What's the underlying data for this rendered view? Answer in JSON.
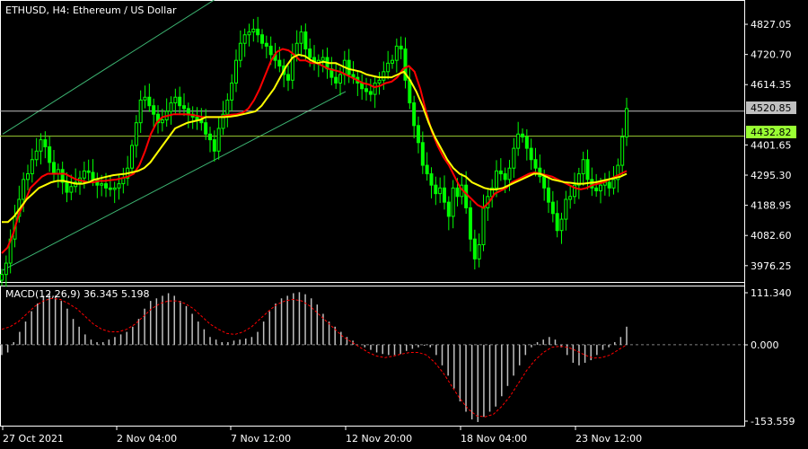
{
  "header": {
    "symbol": "ETHUSD",
    "timeframe": "H4:",
    "description": "Ethereum / US Dollar"
  },
  "indicator": {
    "label": "MACD(12,26,9) 36.345 5.198",
    "top_value": "111.340",
    "zero_value": "0.000",
    "bottom_value": "-153.559"
  },
  "price_scale": [
    "4827.05",
    "4720.70",
    "4614.35",
    "4401.65",
    "4295.30",
    "4188.95",
    "4082.60",
    "3976.25"
  ],
  "badges": {
    "bid": "4520.85",
    "level": "4432.82"
  },
  "time_axis": [
    "27 Oct 2021",
    "2 Nov 04:00",
    "7 Nov 12:00",
    "12 Nov 20:00",
    "18 Nov 04:00",
    "23 Nov 12:00"
  ],
  "colors": {
    "background": "#000000",
    "candles": "#00ff00",
    "ma_fast": "#ff0000",
    "ma_slow": "#ffff00",
    "channel": "#3cb371",
    "bid_line": "#c0c0c0",
    "level_line": "#9acd32",
    "level_badge": "#99ff33",
    "macd_hist": "#c0c0c0",
    "macd_signal": "#ff0000",
    "grid": "#ffffff"
  },
  "chart_data": {
    "type": "candlestick",
    "symbol": "ETHUSD",
    "timeframe": "H4",
    "price_range": [
      3925,
      4900
    ],
    "close": [
      3945,
      3985,
      4070,
      4150,
      4210,
      4280,
      4300,
      4350,
      4380,
      4420,
      4395,
      4340,
      4300,
      4315,
      4270,
      4235,
      4255,
      4270,
      4285,
      4310,
      4305,
      4280,
      4260,
      4265,
      4250,
      4245,
      4250,
      4265,
      4285,
      4320,
      4400,
      4480,
      4560,
      4570,
      4540,
      4510,
      4480,
      4490,
      4520,
      4550,
      4570,
      4540,
      4530,
      4510,
      4500,
      4490,
      4480,
      4440,
      4420,
      4380,
      4460,
      4510,
      4560,
      4620,
      4700,
      4760,
      4790,
      4800,
      4810,
      4790,
      4760,
      4750,
      4720,
      4700,
      4680,
      4650,
      4630,
      4720,
      4760,
      4800,
      4740,
      4710,
      4690,
      4700,
      4710,
      4670,
      4640,
      4620,
      4650,
      4700,
      4650,
      4640,
      4620,
      4600,
      4590,
      4580,
      4620,
      4630,
      4660,
      4690,
      4700,
      4750,
      4740,
      4630,
      4550,
      4470,
      4410,
      4330,
      4300,
      4260,
      4230,
      4250,
      4200,
      4150,
      4250,
      4220,
      4260,
      4180,
      4070,
      4000,
      4050,
      4180,
      4220,
      4250,
      4310,
      4300,
      4280,
      4320,
      4390,
      4440,
      4430,
      4390,
      4350,
      4320,
      4290,
      4250,
      4200,
      4160,
      4100,
      4140,
      4210,
      4220,
      4260,
      4300,
      4350,
      4280,
      4250,
      4240,
      4260,
      4270,
      4250,
      4280,
      4330,
      4430,
      4530
    ],
    "ma_fast": [
      4020,
      4040,
      4090,
      4160,
      4200,
      4250,
      4270,
      4290,
      4300,
      4300,
      4300,
      4300,
      4290,
      4280,
      4275,
      4270,
      4270,
      4275,
      4275,
      4278,
      4280,
      4285,
      4290,
      4300,
      4330,
      4380,
      4440,
      4480,
      4500,
      4505,
      4510,
      4510,
      4510,
      4508,
      4505,
      4500,
      4500,
      4500,
      4500,
      4505,
      4508,
      4510,
      4515,
      4530,
      4560,
      4600,
      4650,
      4700,
      4730,
      4740,
      4735,
      4720,
      4700,
      4700,
      4690,
      4690,
      4680,
      4670,
      4665,
      4660,
      4650,
      4640,
      4630,
      4620,
      4615,
      4605,
      4610,
      4620,
      4625,
      4640,
      4670,
      4680,
      4660,
      4600,
      4520,
      4450,
      4400,
      4360,
      4330,
      4290,
      4250,
      4230,
      4210,
      4190,
      4180,
      4200,
      4230,
      4240,
      4250,
      4270,
      4280,
      4290,
      4300,
      4305,
      4300,
      4295,
      4290,
      4280,
      4270,
      4260,
      4250,
      4245,
      4250,
      4260,
      4265,
      4270,
      4280,
      4290,
      4300,
      4310
    ],
    "ma_slow": [
      4130,
      4130,
      4150,
      4180,
      4210,
      4230,
      4250,
      4260,
      4270,
      4275,
      4275,
      4270,
      4265,
      4265,
      4270,
      4280,
      4285,
      4290,
      4295,
      4298,
      4300,
      4305,
      4310,
      4320,
      4340,
      4370,
      4400,
      4430,
      4460,
      4470,
      4480,
      4485,
      4490,
      4500,
      4500,
      4500,
      4500,
      4502,
      4505,
      4510,
      4515,
      4520,
      4540,
      4570,
      4600,
      4640,
      4680,
      4710,
      4720,
      4715,
      4700,
      4690,
      4695,
      4690,
      4690,
      4680,
      4670,
      4665,
      4660,
      4650,
      4645,
      4640,
      4640,
      4640,
      4650,
      4660,
      4630,
      4590,
      4540,
      4480,
      4430,
      4390,
      4350,
      4320,
      4300,
      4290,
      4270,
      4260,
      4250,
      4245,
      4245,
      4250,
      4260,
      4270,
      4280,
      4290,
      4300,
      4300,
      4290,
      4280,
      4275,
      4270,
      4268,
      4265,
      4265,
      4268,
      4270,
      4275,
      4280,
      4285,
      4290,
      4300
    ],
    "channel": {
      "upper": {
        "from": [
          "27 Oct 2021",
          4440
        ],
        "to": [
          "7 Nov 12:00",
          4950
        ]
      },
      "lower": {
        "from": [
          "27 Oct 2021",
          3960
        ],
        "to": [
          "12 Nov 20:00",
          4590
        ]
      }
    },
    "horizontal_levels": [
      4520.85,
      4432.82
    ],
    "macd": {
      "range": [
        -153.559,
        111.34
      ],
      "histogram": [
        -20,
        -15,
        5,
        25,
        45,
        65,
        80,
        95,
        100,
        95,
        85,
        70,
        50,
        35,
        20,
        10,
        5,
        5,
        10,
        15,
        20,
        25,
        35,
        50,
        70,
        85,
        90,
        95,
        100,
        95,
        85,
        75,
        60,
        45,
        30,
        15,
        10,
        5,
        5,
        8,
        10,
        12,
        15,
        25,
        45,
        65,
        80,
        90,
        95,
        100,
        102,
        98,
        90,
        78,
        60,
        45,
        35,
        25,
        15,
        8,
        0,
        -5,
        -10,
        -15,
        -18,
        -20,
        -20,
        -18,
        -12,
        -8,
        -5,
        -2,
        -5,
        -20,
        -40,
        -60,
        -85,
        -110,
        -130,
        -145,
        -150,
        -140,
        -130,
        -120,
        -100,
        -80,
        -60,
        -40,
        -20,
        -5,
        5,
        10,
        15,
        10,
        -5,
        -20,
        -35,
        -40,
        -35,
        -30,
        -20,
        -10,
        -5,
        5,
        15,
        35
      ],
      "signal": [
        30,
        35,
        45,
        60,
        75,
        85,
        90,
        88,
        80,
        70,
        55,
        40,
        30,
        25,
        25,
        30,
        40,
        55,
        70,
        80,
        85,
        85,
        80,
        70,
        55,
        40,
        30,
        22,
        20,
        25,
        35,
        50,
        65,
        78,
        85,
        88,
        85,
        75,
        60,
        45,
        30,
        15,
        5,
        -5,
        -15,
        -22,
        -25,
        -22,
        -18,
        -15,
        -15,
        -20,
        -35,
        -55,
        -80,
        -105,
        -125,
        -138,
        -140,
        -135,
        -120,
        -100,
        -75,
        -50,
        -30,
        -15,
        -5,
        -3,
        -5,
        -12,
        -20,
        -26,
        -25,
        -20,
        -10,
        0
      ]
    }
  }
}
